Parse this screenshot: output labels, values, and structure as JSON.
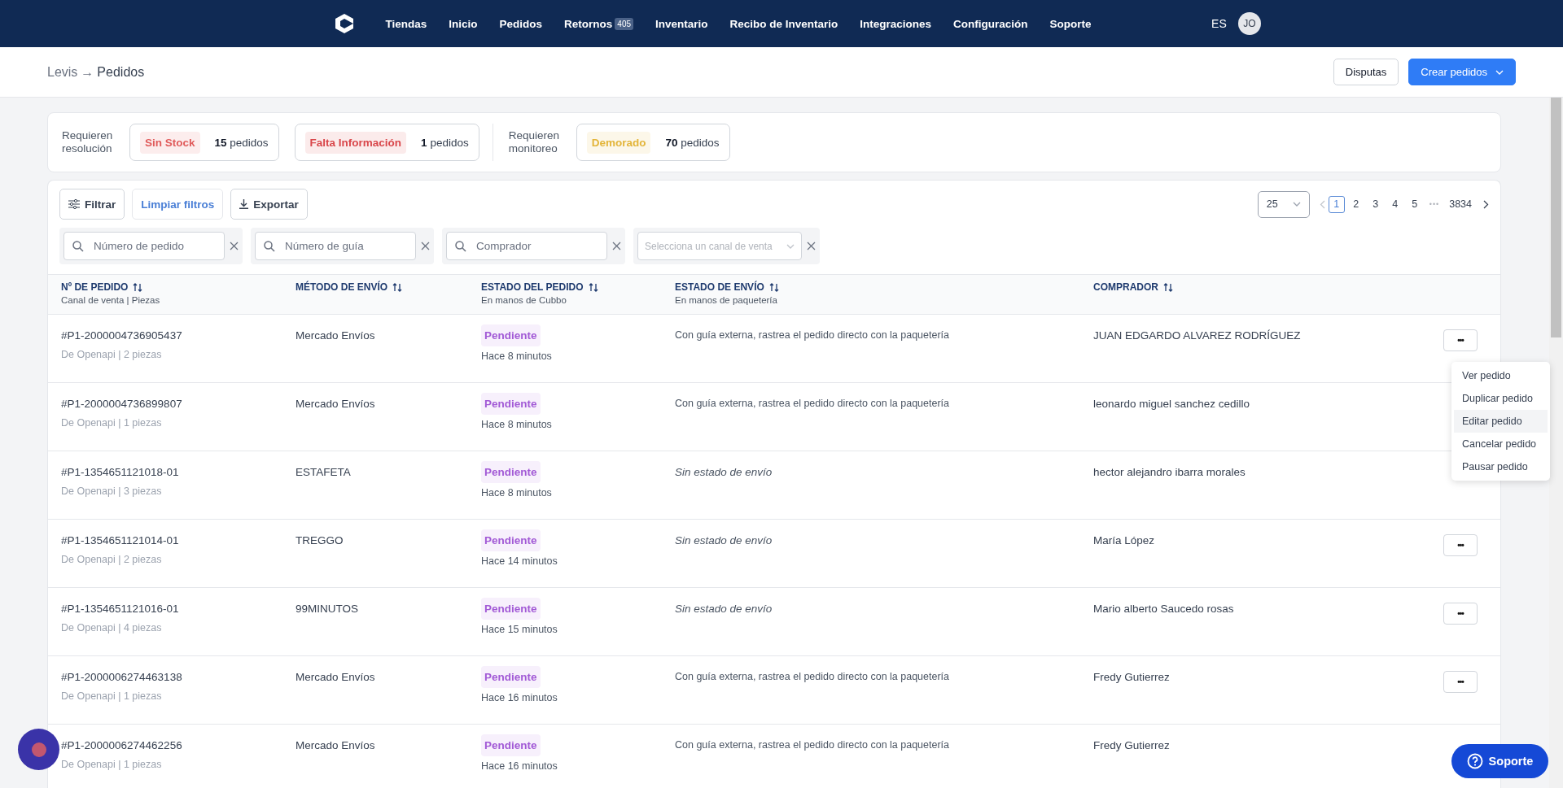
{
  "nav": {
    "items": [
      {
        "label": "Tiendas"
      },
      {
        "label": "Inicio"
      },
      {
        "label": "Pedidos"
      },
      {
        "label": "Retornos",
        "badge": "405"
      },
      {
        "label": "Inventario"
      },
      {
        "label": "Recibo de Inventario"
      },
      {
        "label": "Integraciones"
      },
      {
        "label": "Configuración"
      },
      {
        "label": "Soporte"
      }
    ],
    "language": "ES",
    "avatar": "JO"
  },
  "header": {
    "breadcrumb": "Levis",
    "arrow": "→",
    "title": "Pedidos",
    "buttons": [
      {
        "label": "Disputas",
        "kind": "secondary"
      },
      {
        "label": "Crear pedidos",
        "kind": "primary"
      }
    ]
  },
  "summary": [
    {
      "label": "Requieren resolución",
      "chips": [
        {
          "tag": "Sin Stock",
          "color": "#e05b5b",
          "count": "**15** pedidos"
        },
        {
          "tag": "Falta Información",
          "color": "#d9474b",
          "count": "**1** pedidos"
        }
      ]
    },
    {
      "label": "Requieren monitoreo",
      "chips": [
        {
          "tag": "Demorado",
          "color": "#e3b53a",
          "count": "**70** pedidos"
        }
      ]
    }
  ],
  "toolbar": {
    "buttons": [
      {
        "label": "Filtrar",
        "kind": "filter"
      },
      {
        "label": "Limpiar filtros",
        "kind": "link"
      },
      {
        "label": "Exportar",
        "kind": "export"
      }
    ]
  },
  "pagination": {
    "page_size": "25",
    "pages": [
      {
        "label": "1",
        "selected": true
      },
      {
        "label": "2",
        "selected": false
      },
      {
        "label": "3",
        "selected": false
      },
      {
        "label": "4",
        "selected": false
      },
      {
        "label": "5",
        "selected": false
      }
    ],
    "ellipsis": "•••",
    "last": "3834"
  },
  "filters": [
    {
      "kind": "search",
      "placeholder": "Número de pedido"
    },
    {
      "kind": "search",
      "placeholder": "Número de guía"
    },
    {
      "kind": "search",
      "placeholder": "Comprador"
    },
    {
      "kind": "select",
      "placeholder": "Selecciona un canal de venta"
    }
  ],
  "table": {
    "columns": [
      {
        "title": "Nº DE PEDIDO",
        "subtitle": "Canal de venta | Piezas"
      },
      {
        "title": "MÉTODO DE ENVÍO"
      },
      {
        "title": "ESTADO DEL PEDIDO",
        "subtitle": "En manos de Cubbo"
      },
      {
        "title": "ESTADO DE ENVÍO",
        "subtitle": "En manos de paquetería"
      },
      {
        "title": "COMPRADOR"
      }
    ],
    "rows": [
      {
        "order": "#P1-2000004736905437",
        "origin": "De Openapi | 2 piezas",
        "method": "Mercado Envíos",
        "status": "Pendiente",
        "time": "Hace 8 minutos",
        "shipping": {
          "kind": "note",
          "text": "Con guía externa, rastrea el pedido directo con la paquetería"
        },
        "buyer": "JUAN EDGARDO ALVAREZ RODRÍGUEZ",
        "actions": "•••"
      },
      {
        "order": "#P1-2000004736899807",
        "origin": "De Openapi | 1 piezas",
        "method": "Mercado Envíos",
        "status": "Pendiente",
        "time": "Hace 8 minutos",
        "shipping": {
          "kind": "note",
          "text": "Con guía externa, rastrea el pedido directo con la paquetería"
        },
        "buyer": "leonardo miguel sanchez cedillo"
      },
      {
        "order": "#P1-1354651121018-01",
        "origin": "De Openapi | 3 piezas",
        "method": "ESTAFETA",
        "status": "Pendiente",
        "time": "Hace 8 minutos",
        "shipping": {
          "kind": "empty",
          "text": "Sin estado de envío"
        },
        "buyer": "hector alejandro ibarra morales"
      },
      {
        "order": "#P1-1354651121014-01",
        "origin": "De Openapi | 2 piezas",
        "method": "TREGGO",
        "status": "Pendiente",
        "time": "Hace 14 minutos",
        "shipping": {
          "kind": "empty",
          "text": "Sin estado de envío"
        },
        "buyer": "María López",
        "actions": "•••"
      },
      {
        "order": "#P1-1354651121016-01",
        "origin": "De Openapi | 4 piezas",
        "method": "99MINUTOS",
        "status": "Pendiente",
        "time": "Hace 15 minutos",
        "shipping": {
          "kind": "empty",
          "text": "Sin estado de envío"
        },
        "buyer": "Mario alberto Saucedo rosas",
        "actions": "•••"
      },
      {
        "order": "#P1-2000006274463138",
        "origin": "De Openapi | 1 piezas",
        "method": "Mercado Envíos",
        "status": "Pendiente",
        "time": "Hace 16 minutos",
        "shipping": {
          "kind": "note",
          "text": "Con guía externa, rastrea el pedido directo con la paquetería"
        },
        "buyer": "Fredy Gutierrez",
        "actions": "•••"
      },
      {
        "order": "#P1-2000006274462256",
        "origin": "De Openapi | 1 piezas",
        "method": "Mercado Envíos",
        "status": "Pendiente",
        "time": "Hace 16 minutos",
        "shipping": {
          "kind": "note",
          "text": "Con guía externa, rastrea el pedido directo con la paquetería"
        },
        "buyer": "Fredy Gutierrez"
      }
    ]
  },
  "menu": {
    "items": [
      {
        "label": "Ver pedido",
        "hovered": false
      },
      {
        "label": "Duplicar pedido",
        "hovered": false
      },
      {
        "label": "Editar pedido",
        "hovered": true
      },
      {
        "label": "Cancelar pedido",
        "hovered": false
      },
      {
        "label": "Pausar pedido",
        "hovered": false
      }
    ]
  },
  "support_button": {
    "label": "Soporte"
  }
}
